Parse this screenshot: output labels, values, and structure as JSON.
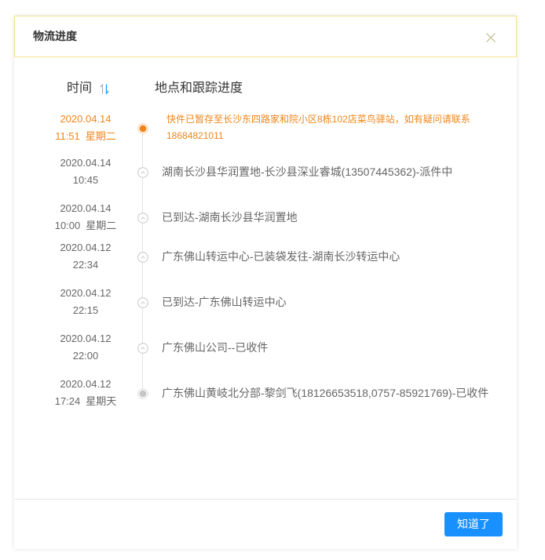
{
  "dialog": {
    "title": "物流进度",
    "close_icon": "close-icon",
    "columns": {
      "time": "时间",
      "sort_icon": "sort-icon",
      "location": "地点和跟踪进度"
    },
    "timeline": [
      {
        "date": "2020.04.14",
        "time": "11:51",
        "weekday": "星期二",
        "lines": [
          "快件已暂存至长沙东四路家和院小区8栋102店菜鸟驿站，如有疑问请联系",
          "18684821011"
        ],
        "node_icon": "latest-dot-icon"
      },
      {
        "date": "2020.04.14",
        "time": "10:45",
        "lines": [
          "湖南长沙县华润置地-长沙县深业睿城(13507445362)-派件中"
        ],
        "node_icon": "chevron-up-circle-icon"
      },
      {
        "date": "2020.04.14",
        "time": "10:00",
        "weekday": "星期二",
        "lines": [
          "已到达-湖南长沙县华润置地"
        ],
        "node_icon": "chevron-up-circle-icon"
      },
      {
        "date": "2020.04.12",
        "time": "22:34",
        "lines": [
          "广东佛山转运中心-已装袋发往-湖南长沙转运中心"
        ],
        "node_icon": "chevron-up-circle-icon"
      },
      {
        "date": "2020.04.12",
        "time": "22:15",
        "lines": [
          "已到达-广东佛山转运中心"
        ],
        "node_icon": "chevron-up-circle-icon"
      },
      {
        "date": "2020.04.12",
        "time": "22:00",
        "lines": [
          "广东佛山公司--已收件"
        ],
        "node_icon": "chevron-up-circle-icon"
      },
      {
        "date": "2020.04.12",
        "time": "17:24",
        "weekday": "星期天",
        "lines": [
          "广东佛山黄岐北分部-黎剑飞(18126653518,0757-85921769)-已收件"
        ],
        "node_icon": "origin-dot-icon"
      }
    ],
    "confirm_label": "知道了"
  },
  "colors": {
    "accent_orange": "#f0861a",
    "primary_blue": "#1890ff",
    "header_border": "#f5e38f",
    "text_gray": "#666666"
  }
}
